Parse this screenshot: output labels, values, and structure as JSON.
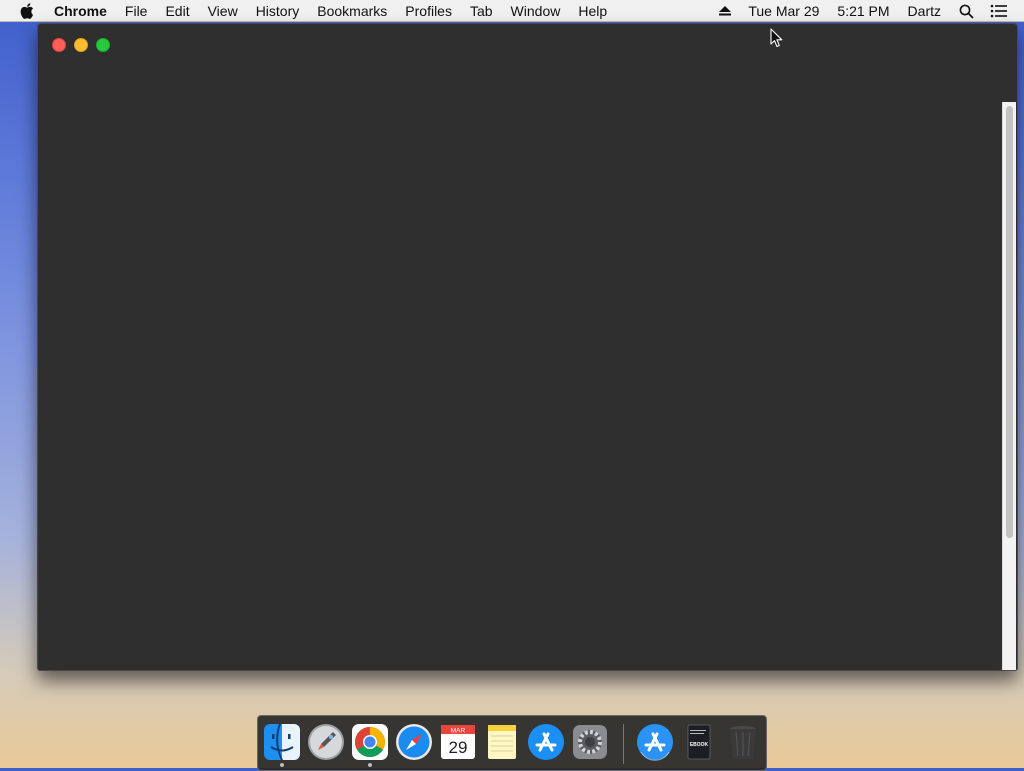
{
  "menubar": {
    "app_name": "Chrome",
    "menus": [
      "File",
      "Edit",
      "View",
      "History",
      "Bookmarks",
      "Profiles",
      "Tab",
      "Window",
      "Help"
    ],
    "date": "Tue Mar 29",
    "time": "5:21 PM",
    "user": "Dartz",
    "icons": [
      "apple-icon",
      "eject-icon",
      "spotlight-search-icon",
      "notification-center-icon"
    ]
  },
  "window": {
    "app": "Chrome",
    "background_color": "#2f2f2f",
    "traffic_lights": [
      "close",
      "minimize",
      "maximize"
    ]
  },
  "dock": {
    "apps": [
      {
        "name": "Finder",
        "icon": "finder-icon",
        "running": true
      },
      {
        "name": "Launchpad",
        "icon": "launchpad-icon",
        "running": false
      },
      {
        "name": "Google Chrome",
        "icon": "chrome-icon",
        "running": true
      },
      {
        "name": "Safari",
        "icon": "safari-icon",
        "running": false
      },
      {
        "name": "Calendar",
        "icon": "calendar-icon",
        "running": false,
        "month": "MAR",
        "day": "29"
      },
      {
        "name": "Notes",
        "icon": "notes-icon",
        "running": false
      },
      {
        "name": "App Store",
        "icon": "app-store-icon",
        "running": false
      },
      {
        "name": "System Preferences",
        "icon": "system-preferences-icon",
        "running": false
      }
    ],
    "others": [
      {
        "name": "App Store Downloads",
        "icon": "app-store-download-icon"
      },
      {
        "name": "Ebook",
        "icon": "ebook-icon",
        "text": "EBOOK"
      },
      {
        "name": "Trash",
        "icon": "trash-icon"
      }
    ]
  },
  "colors": {
    "close": "#fe5f57",
    "minimize": "#febc2e",
    "maximize": "#28c840"
  }
}
